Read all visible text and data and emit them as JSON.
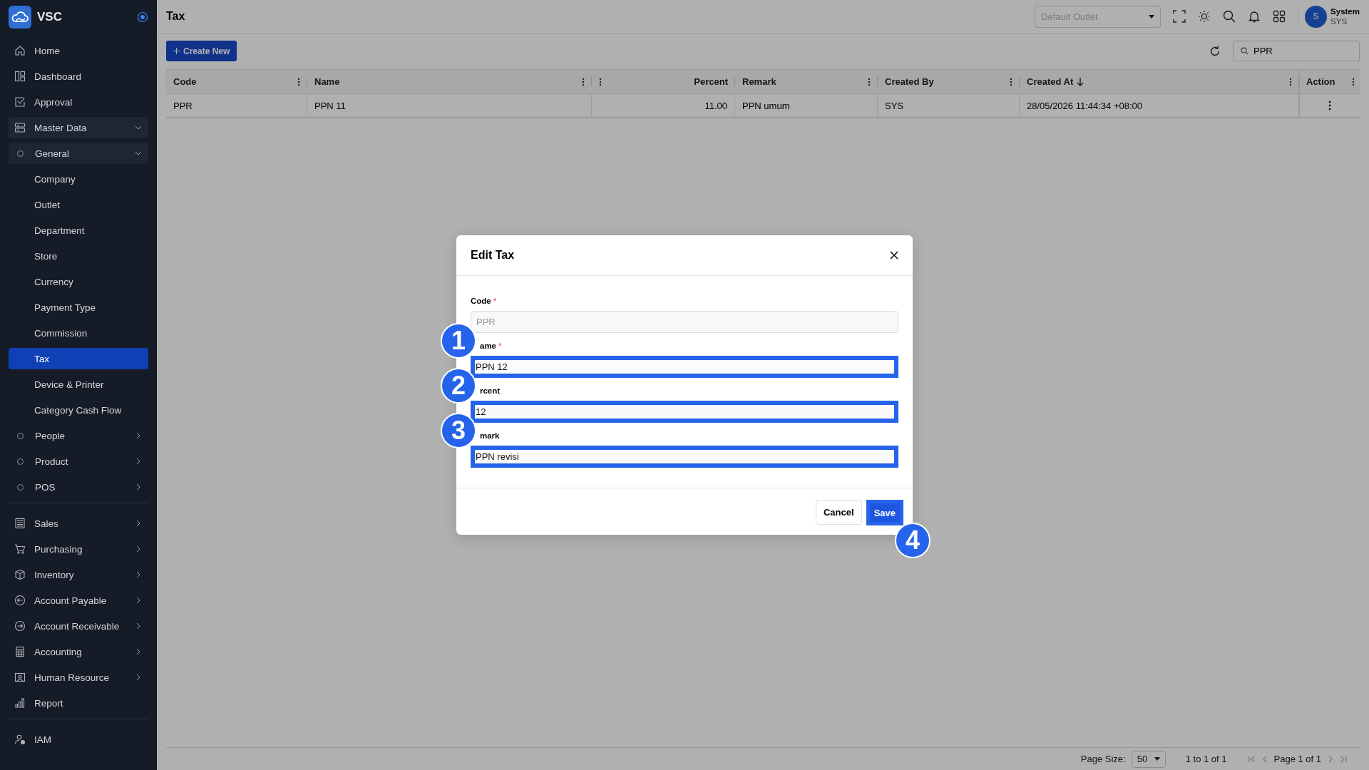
{
  "sidebar": {
    "brand": "VSC",
    "sections": [
      {
        "items": [
          {
            "label": "Home",
            "selected": false
          },
          {
            "label": "Dashboard",
            "selected": false
          },
          {
            "label": "Approval",
            "selected": false
          },
          {
            "label": "Master Data",
            "selected": false,
            "expanded": true,
            "children": [
              {
                "label": "General",
                "selected": false,
                "expanded": true,
                "children": [
                  {
                    "label": "Company",
                    "selected": false
                  },
                  {
                    "label": "Outlet",
                    "selected": false
                  },
                  {
                    "label": "Department",
                    "selected": false
                  },
                  {
                    "label": "Store",
                    "selected": false
                  },
                  {
                    "label": "Currency",
                    "selected": false
                  },
                  {
                    "label": "Payment Type",
                    "selected": false
                  },
                  {
                    "label": "Commission",
                    "selected": false
                  },
                  {
                    "label": "Tax",
                    "selected": true
                  },
                  {
                    "label": "Device & Printer",
                    "selected": false
                  },
                  {
                    "label": "Category Cash Flow",
                    "selected": false
                  }
                ]
              },
              {
                "label": "People",
                "selected": false,
                "expanded": false
              },
              {
                "label": "Product",
                "selected": false,
                "expanded": false
              },
              {
                "label": "POS",
                "selected": false,
                "expanded": false
              }
            ]
          }
        ]
      },
      {
        "items": [
          {
            "label": "Sales",
            "selected": false,
            "expanded": false
          },
          {
            "label": "Purchasing",
            "selected": false,
            "expanded": false
          },
          {
            "label": "Inventory",
            "selected": false,
            "expanded": false
          },
          {
            "label": "Account Payable",
            "selected": false,
            "expanded": false
          },
          {
            "label": "Account Receivable",
            "selected": false,
            "expanded": false
          },
          {
            "label": "Accounting",
            "selected": false,
            "expanded": false
          },
          {
            "label": "Human Resource",
            "selected": false,
            "expanded": false
          },
          {
            "label": "Report",
            "selected": false
          }
        ]
      },
      {
        "items": [
          {
            "label": "IAM",
            "selected": false
          }
        ]
      }
    ]
  },
  "topbar": {
    "title": "Tax",
    "outlet_select": {
      "placeholder": "Default Outlet"
    },
    "user": {
      "initial": "S",
      "name": "System",
      "code": "SYS"
    }
  },
  "toolbar": {
    "create_button": "Create New",
    "search": {
      "value": "PPR"
    }
  },
  "table": {
    "columns": [
      {
        "label": "Code",
        "kind": "text",
        "sorted_descending": false
      },
      {
        "label": "Name",
        "kind": "text",
        "sorted_descending": false
      },
      {
        "label": "Percent",
        "kind": "number",
        "sorted_descending": false
      },
      {
        "label": "Remark",
        "kind": "text",
        "sorted_descending": false
      },
      {
        "label": "Created By",
        "kind": "text",
        "sorted_descending": false
      },
      {
        "label": "Created At",
        "kind": "text",
        "sorted_descending": true
      },
      {
        "label": "Action",
        "kind": "action",
        "sorted_descending": false
      }
    ],
    "rows": [
      {
        "cells": [
          "PPR",
          "PPN 11",
          "11.00",
          "PPN umum",
          "SYS",
          "28/05/2026 11:44:34 +08:00"
        ]
      }
    ]
  },
  "pagination": {
    "page_size_label": "Page Size:",
    "page_size": "50",
    "range": "1 to 1 of 1",
    "page": "Page 1 of 1",
    "can_go_back": false,
    "can_go_forward": false
  },
  "dialog": {
    "title": "Edit Tax",
    "fields": [
      {
        "label": "Code",
        "required_mark": "*",
        "value": "PPR",
        "disabled": true,
        "highlighted": false
      },
      {
        "label": "ame",
        "required_mark": "*",
        "value": "PPN 12",
        "disabled": false,
        "highlighted": true,
        "marker": "1"
      },
      {
        "label": "rcent",
        "value": "12",
        "disabled": false,
        "highlighted": true,
        "marker": "2"
      },
      {
        "label": "mark",
        "value": "PPN revisi",
        "disabled": false,
        "highlighted": true,
        "marker": "3"
      }
    ],
    "cancel_button": "Cancel",
    "save_button": {
      "label": "Save",
      "highlighted": true,
      "marker": "4"
    }
  }
}
